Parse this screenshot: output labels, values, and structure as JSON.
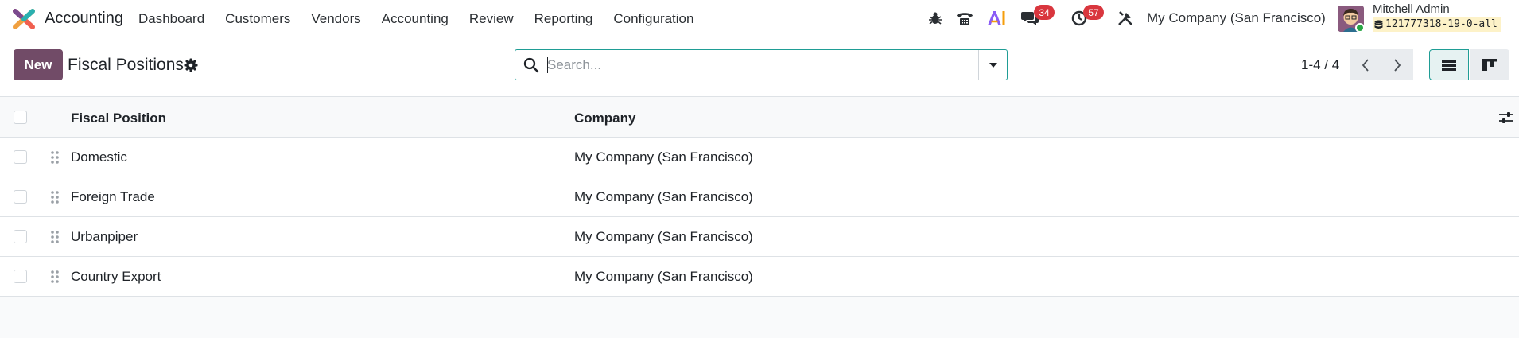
{
  "app": {
    "name": "Accounting",
    "menu": [
      "Dashboard",
      "Customers",
      "Vendors",
      "Accounting",
      "Review",
      "Reporting",
      "Configuration"
    ]
  },
  "systray": {
    "messages_count": "34",
    "activities_count": "57",
    "company": "My Company (San Francisco)",
    "user_name": "Mitchell Admin",
    "database": "121777318-19-0-all"
  },
  "control": {
    "new_label": "New",
    "title": "Fiscal Positions",
    "search_placeholder": "Search...",
    "pager": "1-4 / 4"
  },
  "table": {
    "columns": [
      "Fiscal Position",
      "Company"
    ],
    "rows": [
      {
        "name": "Domestic",
        "company": "My Company (San Francisco)"
      },
      {
        "name": "Foreign Trade",
        "company": "My Company (San Francisco)"
      },
      {
        "name": "Urbanpiper",
        "company": "My Company (San Francisco)"
      },
      {
        "name": "Country Export",
        "company": "My Company (San Francisco)"
      }
    ]
  },
  "colors": {
    "brand": "#714b67",
    "search_border": "#1f9d95",
    "badge": "#d9363e",
    "db_highlight": "#fdf2c8"
  }
}
